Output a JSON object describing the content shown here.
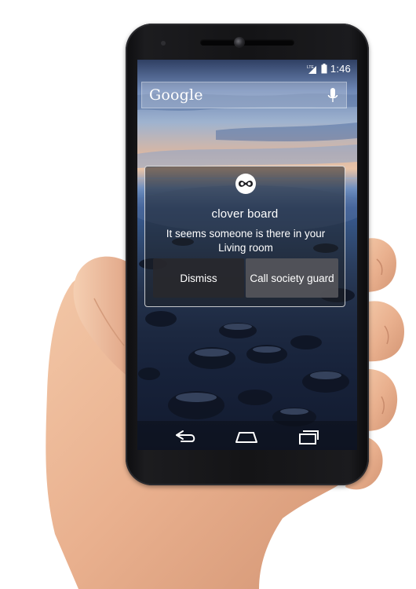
{
  "status_bar": {
    "network": "LTE",
    "time": "1:46"
  },
  "search": {
    "logo": "Google"
  },
  "notification": {
    "title": "clover board",
    "message": "It seems someone is there in your Living room",
    "dismiss_label": "Dismiss",
    "call_label": "Call society guard"
  },
  "icons": {
    "mic": "microphone-icon",
    "app": "clover-board-logo-icon",
    "back": "back-icon",
    "home": "home-icon",
    "recents": "recent-apps-icon",
    "signal": "signal-icon",
    "battery": "battery-icon"
  }
}
